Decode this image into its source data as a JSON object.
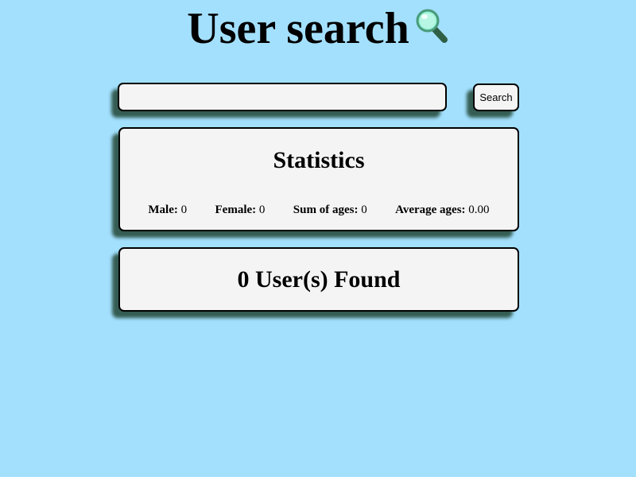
{
  "header": {
    "title": "User search",
    "icon": "magnifying-glass-icon"
  },
  "search": {
    "value": "",
    "placeholder": "",
    "button_label": "Search"
  },
  "statistics": {
    "title": "Statistics",
    "male_label": "Male:",
    "male_value": "0",
    "female_label": "Female:",
    "female_value": "0",
    "sum_label": "Sum of ages:",
    "sum_value": "0",
    "avg_label": "Average ages:",
    "avg_value": "0.00"
  },
  "results": {
    "text": "0 User(s) Found"
  },
  "colors": {
    "background": "#a3e0fe",
    "card": "#f4f4f4",
    "shadow": "#345c52"
  }
}
